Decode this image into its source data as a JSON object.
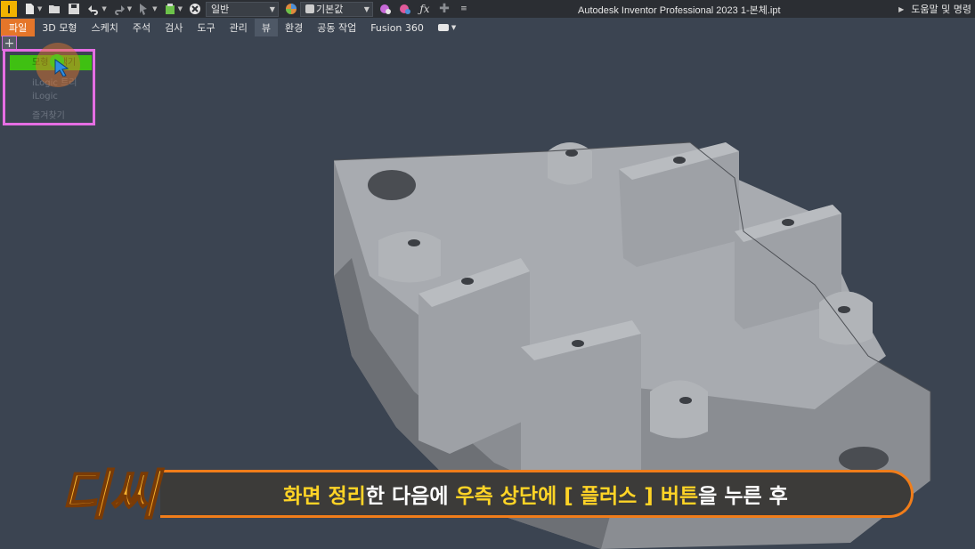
{
  "titlebar": {
    "app_logo": "I",
    "style_select": "일반",
    "material_select": "기본값",
    "app_title": "Autodesk Inventor Professional 2023     1-본체.ipt",
    "help_label": "도움말 및 명령",
    "icons": [
      "new-icon",
      "open-icon",
      "save-icon",
      "undo-icon",
      "redo-icon",
      "select-icon",
      "update-icon",
      "clear-icon",
      "color-wheel-icon",
      "material-icon",
      "appearance-icon",
      "appearance-clear-icon",
      "fx-icon",
      "add-icon",
      "customize-icon"
    ]
  },
  "ribbon": {
    "tabs": [
      {
        "label": "파일"
      },
      {
        "label": "3D 모형"
      },
      {
        "label": "스케치"
      },
      {
        "label": "주석"
      },
      {
        "label": "검사"
      },
      {
        "label": "도구"
      },
      {
        "label": "관리"
      },
      {
        "label": "뷰"
      },
      {
        "label": "환경"
      },
      {
        "label": "공동 작업"
      },
      {
        "label": "Fusion 360"
      }
    ],
    "active_tab": "뷰"
  },
  "browser": {
    "plus_symbol": "+",
    "menu_items": [
      {
        "label": "모형 검색기"
      },
      {
        "label": "iLogic 트리"
      },
      {
        "label": "iLogic"
      },
      {
        "label": "즐겨찾기"
      }
    ]
  },
  "caption": {
    "brand": "디씨",
    "parts": [
      {
        "text": "화면 정리",
        "highlight": true
      },
      {
        "text": "한 다음에 ",
        "highlight": false
      },
      {
        "text": "우측 상단에 [ 플러스 ] 버튼",
        "highlight": true
      },
      {
        "text": "을 누른 후",
        "highlight": false
      }
    ]
  },
  "colors": {
    "viewport_bg": "#3b4451",
    "file_tab": "#e5762a",
    "highlight_green": "#3fc012",
    "pink_outline": "#e56ee3",
    "caption_border": "#f07d1a",
    "caption_highlight": "#ffd426"
  }
}
